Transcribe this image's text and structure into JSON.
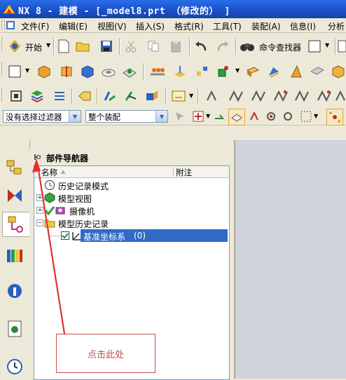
{
  "window": {
    "title": "NX 8 - 建模 - [_model8.prt （修改的） ]"
  },
  "menubar": {
    "items": [
      "文件(F)",
      "编辑(E)",
      "视图(V)",
      "插入(S)",
      "格式(R)",
      "工具(T)",
      "装配(A)",
      "信息(I)",
      "分析"
    ]
  },
  "toolbar": {
    "start_label": "开始",
    "command_finder_label": "命令查找器"
  },
  "selection_bar": {
    "filter_value": "没有选择过滤器",
    "scope_value": "整个装配"
  },
  "navigator": {
    "title": "部件导航器",
    "columns": [
      "名称",
      "附注"
    ],
    "nodes": [
      {
        "label": "历史记录模式",
        "icon": "clock-icon"
      },
      {
        "label": "模型视图",
        "icon": "model-views-icon"
      },
      {
        "label": "摄像机",
        "icon": "camera-icon"
      },
      {
        "label": "模型历史记录",
        "icon": "folder-icon"
      },
      {
        "label": "基准坐标系",
        "suffix": "(0)",
        "icon": "datum-csys-icon",
        "checked": true,
        "selected": true
      }
    ]
  },
  "callout": {
    "text": "点击此处"
  },
  "colors": {
    "title_blue": "#1a4fc8",
    "selection": "#316ac5",
    "callout_red": "#c0504d"
  }
}
